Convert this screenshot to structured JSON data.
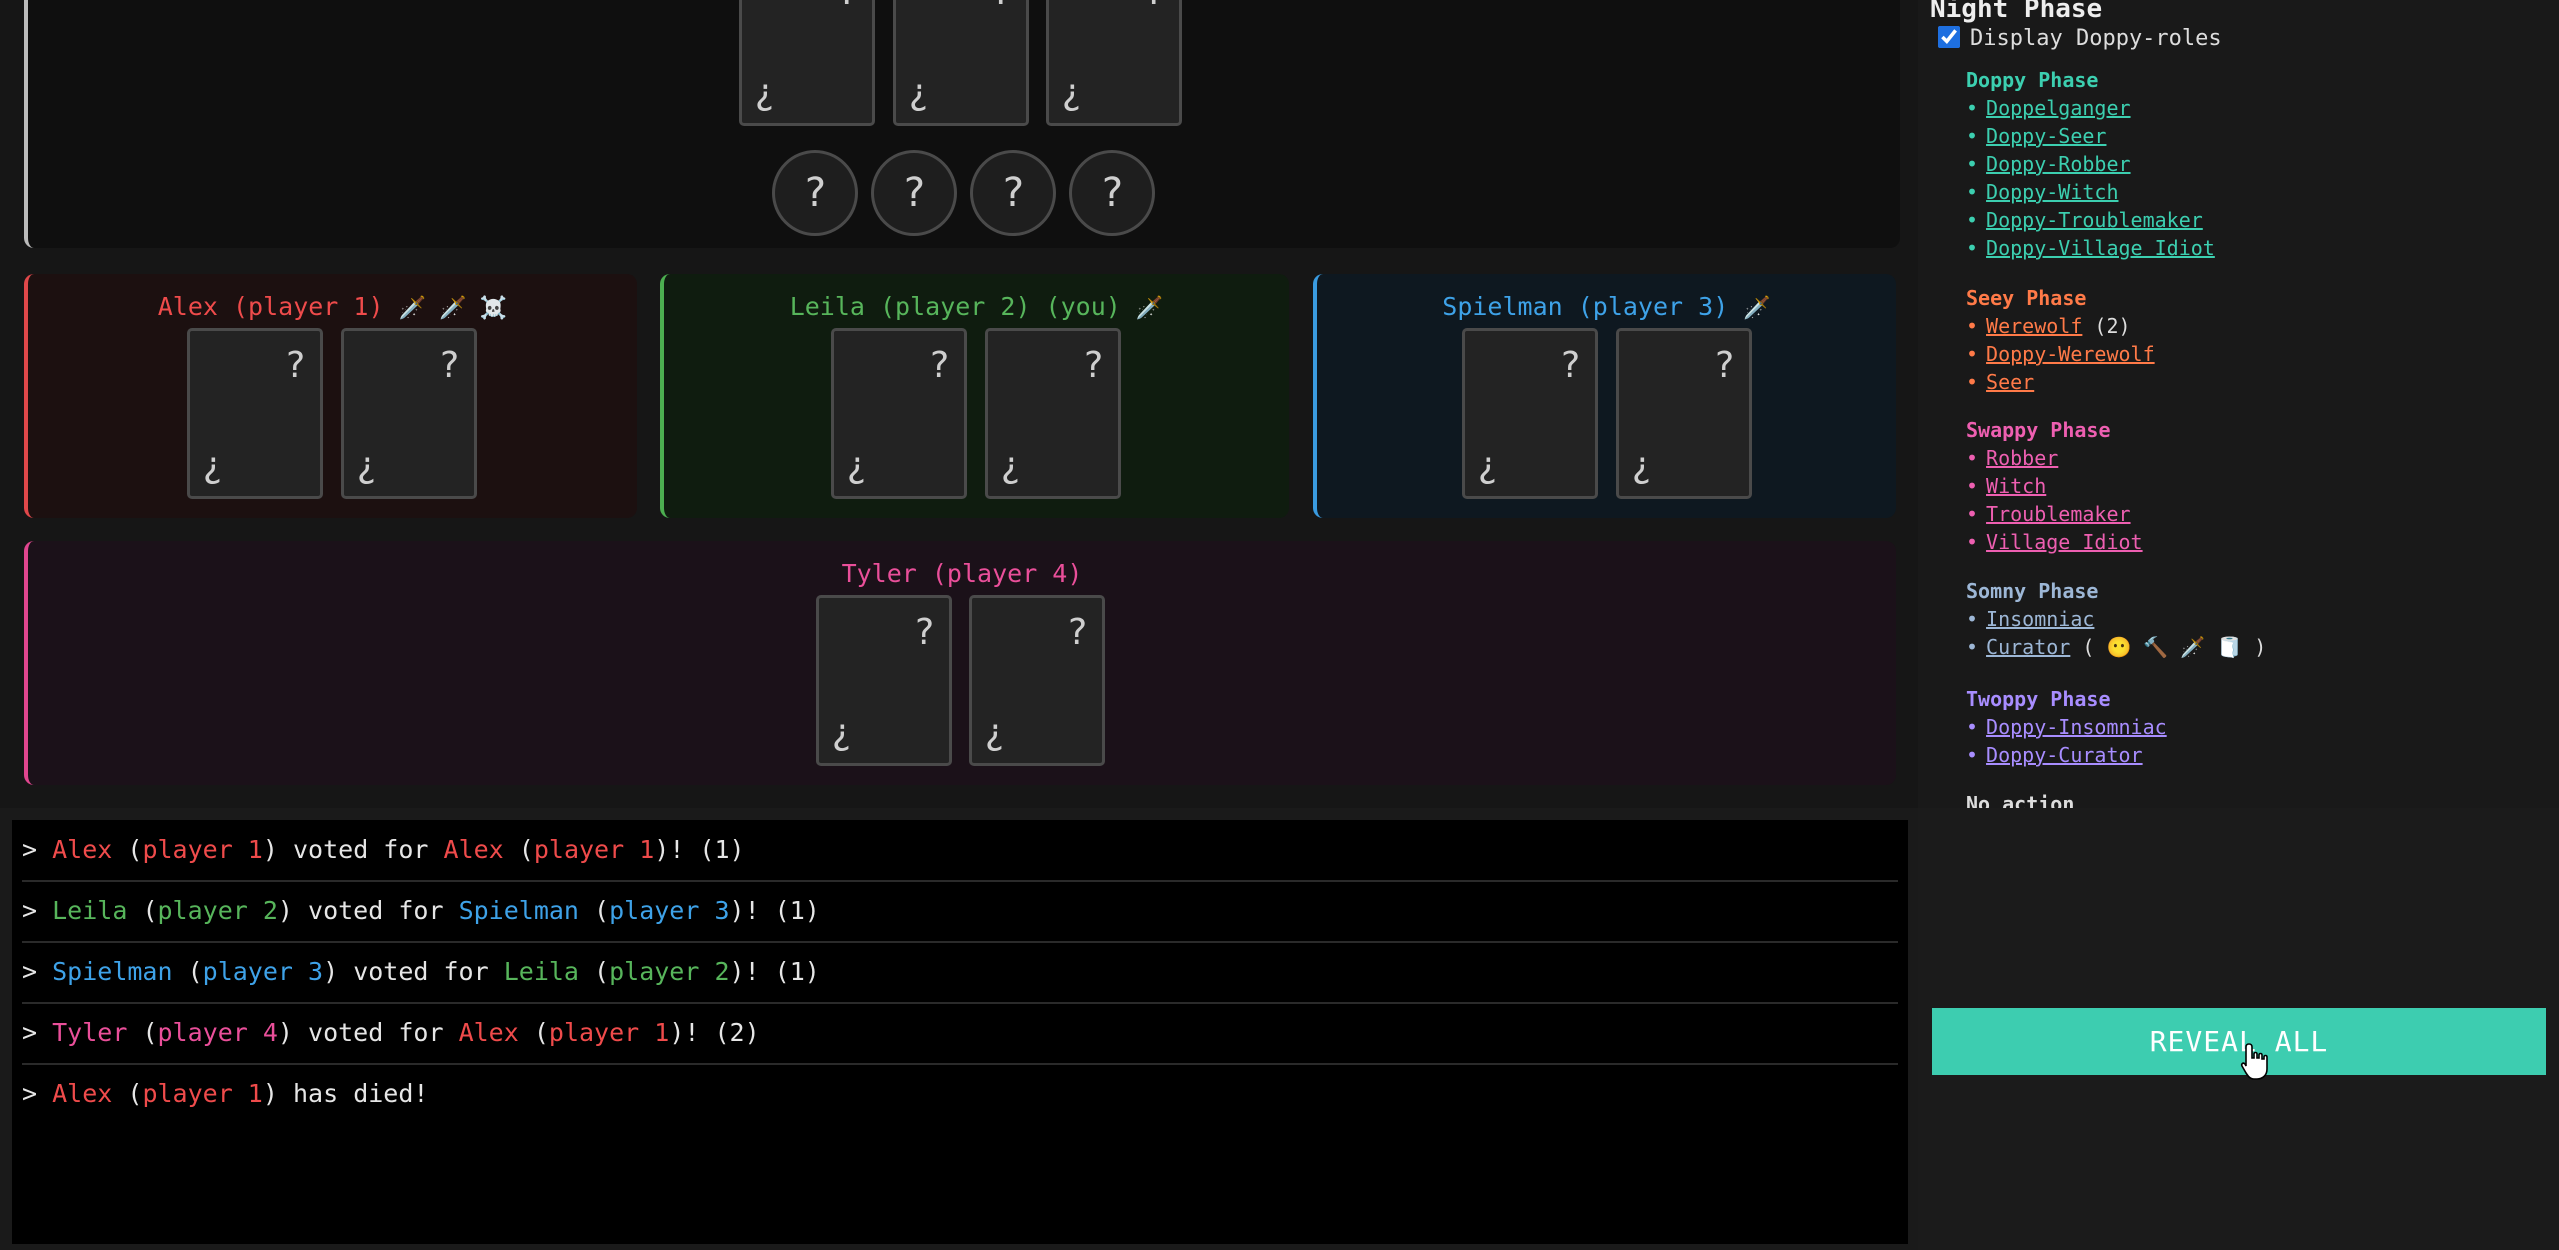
{
  "center": {
    "card_q": "?",
    "card_iq": "¿",
    "coin_label": "?"
  },
  "players": {
    "alex": {
      "name": "Alex (player 1)",
      "badges": "🗡️ 🗡️ ☠️"
    },
    "leila": {
      "name": "Leila (player 2) (you)",
      "badges": "🗡️"
    },
    "spielman": {
      "name": "Spielman (player 3)",
      "badges": "🗡️"
    },
    "tyler": {
      "name": "Tyler (player 4)",
      "badges": ""
    }
  },
  "log": [
    {
      "a": "Alex",
      "ap": "player 1",
      "b": "Alex",
      "bp": "player 1",
      "count": "(1)"
    },
    {
      "a": "Leila",
      "ap": "player 2",
      "b": "Spielman",
      "bp": "player 3",
      "count": "(1)"
    },
    {
      "a": "Spielman",
      "ap": "player 3",
      "b": "Leila",
      "bp": "player 2",
      "count": "(1)"
    },
    {
      "a": "Tyler",
      "ap": "player 4",
      "b": "Alex",
      "bp": "player 1",
      "count": "(2)"
    }
  ],
  "log_strings": {
    "prompt": ">",
    "voted_for": "voted for",
    "died": "has died!",
    "died_name": "Alex",
    "died_player": "player 1"
  },
  "sidebar": {
    "title": "Night Phase",
    "display_label": "Display Doppy-roles",
    "doppy_phase": {
      "title": "Doppy Phase",
      "items": [
        "Doppelganger",
        "Doppy-Seer",
        "Doppy-Robber",
        "Doppy-Witch",
        "Doppy-Troublemaker",
        "Doppy-Village Idiot"
      ]
    },
    "seey_phase": {
      "title": "Seey Phase",
      "items": [
        "Werewolf",
        "Doppy-Werewolf",
        "Seer"
      ],
      "werewolf_count": "(2)"
    },
    "swappy_phase": {
      "title": "Swappy Phase",
      "items": [
        "Robber",
        "Witch",
        "Troublemaker",
        "Village Idiot"
      ]
    },
    "somny_phase": {
      "title": "Somny Phase",
      "items": [
        "Insomniac",
        "Curator"
      ],
      "curator_tokens": "( 😶 🔨 🗡️ 🧻 )"
    },
    "twoppy_phase": {
      "title": "Twoppy Phase",
      "items": [
        "Doppy-Insomniac",
        "Doppy-Curator"
      ]
    },
    "no_action": "No action"
  },
  "reveal_button": "REVEAL ALL",
  "colors": {
    "alex": "#ef4b4b",
    "leila": "#57b55b",
    "spielman": "#3ea2e8",
    "tyler": "#ea4f9a",
    "reveal": "#3dcdb0"
  }
}
